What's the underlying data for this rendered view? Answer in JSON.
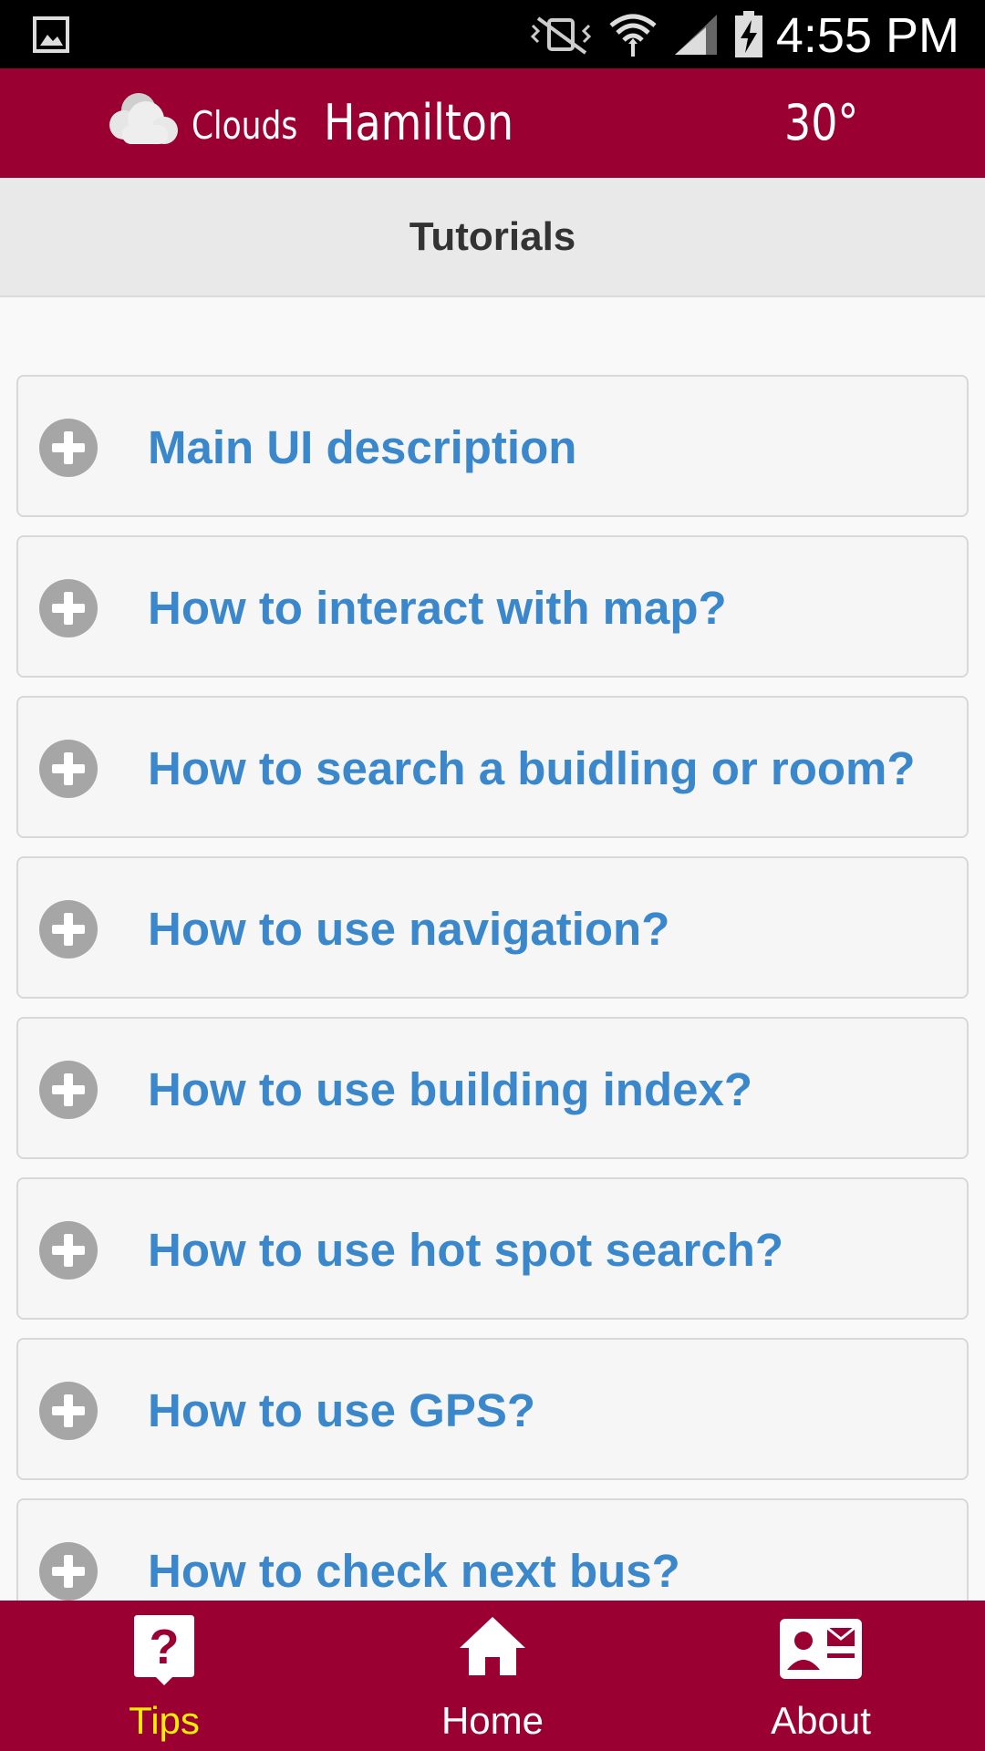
{
  "status_bar": {
    "time": "4:55 PM",
    "icons": [
      "gallery-icon",
      "mute-vibrate-icon",
      "wifi-icon",
      "signal-icon",
      "battery-charging-icon"
    ]
  },
  "header": {
    "condition": "Clouds",
    "city": "Hamilton",
    "temperature": "30°",
    "background_color": "#9b0033"
  },
  "page": {
    "title": "Tutorials"
  },
  "tutorials": [
    {
      "label": "Main UI description"
    },
    {
      "label": "How to interact with map?"
    },
    {
      "label": "How to search a buidling or room?"
    },
    {
      "label": "How to use navigation?"
    },
    {
      "label": "How to use building index?"
    },
    {
      "label": "How to use hot spot search?"
    },
    {
      "label": "How to use GPS?"
    },
    {
      "label": "How to check next bus?"
    }
  ],
  "bottom_nav": {
    "items": [
      {
        "label": "Tips",
        "icon": "question-bubble-icon",
        "active": true
      },
      {
        "label": "Home",
        "icon": "home-icon",
        "active": false
      },
      {
        "label": "About",
        "icon": "contact-card-icon",
        "active": false
      }
    ],
    "active_color": "#ffee00"
  },
  "colors": {
    "accent": "#9b0033",
    "link": "#3a87cc"
  }
}
